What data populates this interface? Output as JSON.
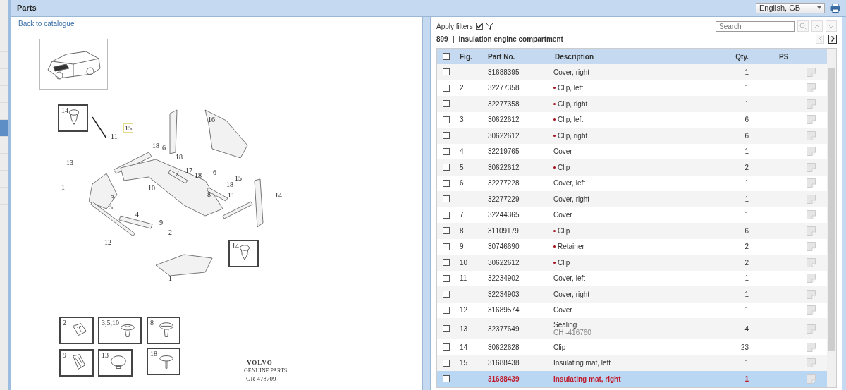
{
  "header": {
    "title": "Parts",
    "language": "English, GB"
  },
  "nav_strip": {
    "items": [
      {
        "selected": false
      },
      {
        "selected": false
      },
      {
        "selected": false
      },
      {
        "selected": false
      },
      {
        "selected": false
      },
      {
        "selected": false
      },
      {
        "selected": false
      },
      {
        "selected": true
      },
      {
        "selected": false
      },
      {
        "selected": false
      },
      {
        "selected": false
      },
      {
        "selected": false
      },
      {
        "selected": false
      },
      {
        "selected": false
      }
    ]
  },
  "left": {
    "back_link": "Back to catalogue",
    "diagram": {
      "callouts": [
        {
          "text": "15",
          "highlighted": true
        },
        {
          "text": "11",
          "highlighted": false
        },
        {
          "text": "18",
          "highlighted": false
        },
        {
          "text": "6",
          "highlighted": false
        },
        {
          "text": "18",
          "highlighted": false
        },
        {
          "text": "16",
          "highlighted": false
        },
        {
          "text": "13",
          "highlighted": false
        },
        {
          "text": "1",
          "highlighted": false
        },
        {
          "text": "3",
          "highlighted": false
        },
        {
          "text": "5",
          "highlighted": false
        },
        {
          "text": "4",
          "highlighted": false
        },
        {
          "text": "10",
          "highlighted": false
        },
        {
          "text": "7",
          "highlighted": false
        },
        {
          "text": "17",
          "highlighted": false
        },
        {
          "text": "18",
          "highlighted": false
        },
        {
          "text": "6",
          "highlighted": false
        },
        {
          "text": "18",
          "highlighted": false
        },
        {
          "text": "15",
          "highlighted": false
        },
        {
          "text": "8",
          "highlighted": false
        },
        {
          "text": "11",
          "highlighted": false
        },
        {
          "text": "14",
          "highlighted": false
        },
        {
          "text": "9",
          "highlighted": false
        },
        {
          "text": "2",
          "highlighted": false
        },
        {
          "text": "12",
          "highlighted": false
        },
        {
          "text": "1",
          "highlighted": false
        }
      ],
      "insets": [
        "14",
        "14"
      ],
      "small_parts": [
        {
          "label": "2",
          "kind": "clip"
        },
        {
          "label": "3,5,10",
          "kind": "push"
        },
        {
          "label": "8",
          "kind": "nut"
        },
        {
          "label": "9",
          "kind": "retainer"
        },
        {
          "label": "13",
          "kind": "plug"
        },
        {
          "label": "18",
          "kind": "screw"
        }
      ],
      "brand": "VOLVO",
      "brand_sub": "GENUINE PARTS",
      "ref": "GR-478709"
    }
  },
  "right": {
    "apply_filters": {
      "label": "Apply filters",
      "checked": true
    },
    "search": {
      "placeholder": "Search"
    },
    "group": {
      "number": "899",
      "separator": "|",
      "title": "insulation engine compartment"
    },
    "table": {
      "columns": [
        "Fig.",
        "Part No.",
        "Description",
        "Qty.",
        "PS"
      ],
      "all_checked": false,
      "rows": [
        {
          "part_no": "31688395",
          "description": "Cover, right",
          "qty": "1",
          "bullet": false,
          "checked": false,
          "selected": false
        },
        {
          "fig": "2",
          "part_no": "32277358",
          "description": "Clip, left",
          "qty": "1",
          "bullet": true,
          "checked": false,
          "selected": false
        },
        {
          "part_no": "32277358",
          "description": "Clip, right",
          "qty": "1",
          "bullet": true,
          "checked": false,
          "selected": false
        },
        {
          "fig": "3",
          "part_no": "30622612",
          "description": "Clip, left",
          "qty": "6",
          "bullet": true,
          "checked": false,
          "selected": false
        },
        {
          "part_no": "30622612",
          "description": "Clip, right",
          "qty": "6",
          "bullet": true,
          "checked": false,
          "selected": false
        },
        {
          "fig": "4",
          "part_no": "32219765",
          "description": "Cover",
          "qty": "1",
          "bullet": false,
          "checked": false,
          "selected": false
        },
        {
          "fig": "5",
          "part_no": "30622612",
          "description": "Clip",
          "qty": "2",
          "bullet": true,
          "checked": false,
          "selected": false
        },
        {
          "fig": "6",
          "part_no": "32277228",
          "description": "Cover, left",
          "qty": "1",
          "bullet": false,
          "checked": false,
          "selected": false
        },
        {
          "part_no": "32277229",
          "description": "Cover, right",
          "qty": "1",
          "bullet": false,
          "checked": false,
          "selected": false
        },
        {
          "fig": "7",
          "part_no": "32244365",
          "description": "Cover",
          "qty": "1",
          "bullet": false,
          "checked": false,
          "selected": false
        },
        {
          "fig": "8",
          "part_no": "31109179",
          "description": "Clip",
          "qty": "6",
          "bullet": true,
          "checked": false,
          "selected": false
        },
        {
          "fig": "9",
          "part_no": "30746690",
          "description": "Retainer",
          "qty": "2",
          "bullet": true,
          "checked": false,
          "selected": false
        },
        {
          "fig": "10",
          "part_no": "30622612",
          "description": "Clip",
          "qty": "2",
          "bullet": true,
          "checked": false,
          "selected": false
        },
        {
          "fig": "11",
          "part_no": "32234902",
          "description": "Cover, left",
          "qty": "1",
          "bullet": false,
          "checked": false,
          "selected": false
        },
        {
          "part_no": "32234903",
          "description": "Cover, right",
          "qty": "1",
          "bullet": false,
          "checked": false,
          "selected": false
        },
        {
          "fig": "12",
          "part_no": "31689574",
          "description": "Cover",
          "qty": "1",
          "bullet": false,
          "checked": false,
          "selected": false
        },
        {
          "fig": "13",
          "part_no": "32377649",
          "description": "Sealing",
          "note": "CH -416760",
          "qty": "4",
          "bullet": false,
          "checked": false,
          "selected": false
        },
        {
          "fig": "14",
          "part_no": "30622628",
          "description": "Clip",
          "qty": "23",
          "bullet": false,
          "checked": false,
          "selected": false
        },
        {
          "fig": "15",
          "part_no": "31688438",
          "description": "Insulating mat, left",
          "qty": "1",
          "bullet": false,
          "checked": false,
          "selected": false
        },
        {
          "part_no": "31688439",
          "description": "Insulating mat, right",
          "qty": "1",
          "bullet": false,
          "checked": false,
          "selected": true
        }
      ]
    }
  }
}
